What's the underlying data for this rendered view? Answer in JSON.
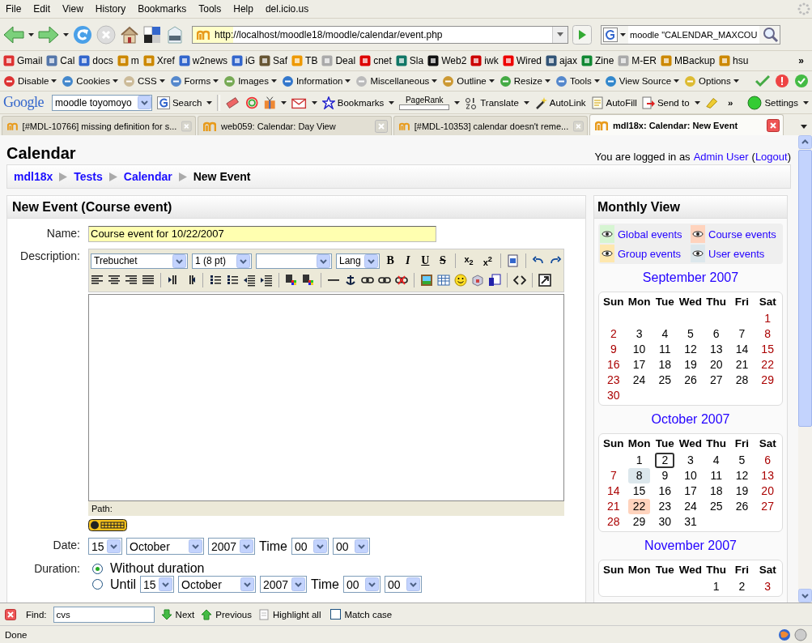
{
  "menu": [
    "File",
    "Edit",
    "View",
    "History",
    "Bookmarks",
    "Tools",
    "Help",
    "del.icio.us"
  ],
  "navigation": {
    "url": "http://localhost/moodle18/moodle/calendar/event.php",
    "search_value": "moodle \"CALENDAR_MAXCOU"
  },
  "bookmarks": [
    "Gmail",
    "Cal",
    "docs",
    "m",
    "Xref",
    "w2news",
    "iG",
    "Saf",
    "TB",
    "Deal",
    "cnet",
    "Sla",
    "Web2",
    "iwk",
    "Wired",
    "ajax",
    "Zine",
    "M-ER",
    "MBackup",
    "hsu"
  ],
  "bookmarks_overflow": "»",
  "developer_toolbar": [
    "Disable",
    "Cookies",
    "CSS",
    "Forms",
    "Images",
    "Information",
    "Miscellaneous",
    "Outline",
    "Resize",
    "Tools",
    "View Source",
    "Options"
  ],
  "google_toolbar": {
    "logo": "Google",
    "query": "moodle toyomoyo",
    "search": "Search",
    "bookmarks": "Bookmarks",
    "pagerank": "PageRank",
    "translate": "Translate",
    "autolink": "AutoLink",
    "autofill": "AutoFill",
    "send_to": "Send to",
    "overflow": "»",
    "settings": "Settings"
  },
  "tabs": [
    {
      "title": "[#MDL-10766] missing definition for s...",
      "selected": false
    },
    {
      "title": "web059: Calendar: Day View",
      "selected": false
    },
    {
      "title": "[#MDL-10353] calendar doesn't reme...",
      "selected": false
    },
    {
      "title": "mdl18x: Calendar: New Event",
      "selected": true
    }
  ],
  "page": {
    "title": "Calendar",
    "login": {
      "prefix": "You are logged in as",
      "user": "Admin User",
      "open": "(",
      "logout": "Logout",
      "close": ")"
    },
    "breadcrumb": [
      {
        "label": "mdl18x",
        "link": true
      },
      {
        "label": "Tests",
        "link": true
      },
      {
        "label": "Calendar",
        "link": true
      },
      {
        "label": "New Event",
        "link": false
      }
    ]
  },
  "form": {
    "heading": "New Event (Course event)",
    "name_label": "Name:",
    "name_value": "Course event for 10/22/2007",
    "description_label": "Description:",
    "editor": {
      "font": "Trebuchet",
      "size": "1 (8 pt)",
      "lang": "Lang",
      "format_buttons": [
        {
          "label": "B",
          "kind": "bold"
        },
        {
          "label": "I",
          "kind": "italic"
        },
        {
          "label": "U",
          "kind": "underline"
        },
        {
          "label": "S",
          "kind": "strike"
        }
      ],
      "script_buttons": [
        "x$_{2}$",
        "x$^{2}$"
      ],
      "path_label": "Path:"
    },
    "date_label": "Date:",
    "date": {
      "day": "15",
      "month": "October",
      "year": "2007",
      "time_label": "Time",
      "hour": "00",
      "minute": "00"
    },
    "duration_label": "Duration:",
    "duration_options": [
      {
        "label": "Without duration",
        "selected": true
      },
      {
        "label": "Until",
        "selected": false,
        "date": {
          "day": "15",
          "month": "October",
          "year": "2007",
          "time_label": "Time",
          "hour": "00",
          "minute": "00"
        }
      }
    ]
  },
  "sidebar": {
    "title": "Monthly View",
    "legend": [
      {
        "label": "Global events",
        "color": "#d6f5d2"
      },
      {
        "label": "Course events",
        "color": "#ffd3bd"
      },
      {
        "label": "Group events",
        "color": "#fee7ae"
      },
      {
        "label": "User events",
        "color": "#dce7ec"
      }
    ],
    "months": [
      {
        "title": "September 2007",
        "weekdays": [
          "Sun",
          "Mon",
          "Tue",
          "Wed",
          "Thu",
          "Fri",
          "Sat"
        ],
        "weeks": [
          [
            {
              "day": "1",
              "today": false
            }
          ],
          [
            {
              "day": "2",
              "today": false
            },
            {
              "day": "3",
              "today": false
            },
            {
              "day": "4",
              "today": false
            },
            {
              "day": "5",
              "today": false
            },
            {
              "day": "6",
              "today": false
            },
            {
              "day": "7",
              "today": false
            },
            {
              "day": "8",
              "today": false
            }
          ],
          [
            {
              "day": "9",
              "today": false
            },
            {
              "day": "10",
              "today": false
            },
            {
              "day": "11",
              "today": false
            },
            {
              "day": "12",
              "today": false
            },
            {
              "day": "13",
              "today": false
            },
            {
              "day": "14",
              "today": false
            },
            {
              "day": "15",
              "today": false
            }
          ],
          [
            {
              "day": "16",
              "today": false
            },
            {
              "day": "17",
              "today": false
            },
            {
              "day": "18",
              "today": false
            },
            {
              "day": "19",
              "today": false
            },
            {
              "day": "20",
              "today": false
            },
            {
              "day": "21",
              "today": false
            },
            {
              "day": "22",
              "today": false
            }
          ],
          [
            {
              "day": "23",
              "today": false
            },
            {
              "day": "24",
              "today": false
            },
            {
              "day": "25",
              "today": false
            },
            {
              "day": "26",
              "today": false
            },
            {
              "day": "27",
              "today": false
            },
            {
              "day": "28",
              "today": false
            },
            {
              "day": "29",
              "today": false
            }
          ],
          [
            {
              "day": "30",
              "today": false
            }
          ]
        ]
      },
      {
        "title": "October 2007",
        "weekdays": [
          "Sun",
          "Mon",
          "Tue",
          "Wed",
          "Thu",
          "Fri",
          "Sat"
        ],
        "weeks": [
          [
            {
              "day": "1",
              "today": false
            },
            {
              "day": "2",
              "today": true
            },
            {
              "day": "3",
              "today": false
            },
            {
              "day": "4",
              "today": false
            },
            {
              "day": "5",
              "today": false
            },
            {
              "day": "6",
              "today": false
            }
          ],
          [
            {
              "day": "7",
              "today": false
            },
            {
              "day": "8",
              "today": false,
              "color": "#dce7ec"
            },
            {
              "day": "9",
              "today": false
            },
            {
              "day": "10",
              "today": false
            },
            {
              "day": "11",
              "today": false
            },
            {
              "day": "12",
              "today": false
            },
            {
              "day": "13",
              "today": false
            }
          ],
          [
            {
              "day": "14",
              "today": false
            },
            {
              "day": "15",
              "today": false
            },
            {
              "day": "16",
              "today": false
            },
            {
              "day": "17",
              "today": false
            },
            {
              "day": "18",
              "today": false
            },
            {
              "day": "19",
              "today": false
            },
            {
              "day": "20",
              "today": false
            }
          ],
          [
            {
              "day": "21",
              "today": false
            },
            {
              "day": "22",
              "today": false,
              "color": "#ffd3bd"
            },
            {
              "day": "23",
              "today": false
            },
            {
              "day": "24",
              "today": false
            },
            {
              "day": "25",
              "today": false
            },
            {
              "day": "26",
              "today": false
            },
            {
              "day": "27",
              "today": false
            }
          ],
          [
            {
              "day": "28",
              "today": false
            },
            {
              "day": "29",
              "today": false
            },
            {
              "day": "30",
              "today": false
            },
            {
              "day": "31",
              "today": false
            }
          ]
        ]
      },
      {
        "title": "November 2007",
        "weekdays": [
          "Sun",
          "Mon",
          "Tue",
          "Wed",
          "Thu",
          "Fri",
          "Sat"
        ],
        "weeks": [
          [
            {
              "day": "1",
              "today": false
            },
            {
              "day": "2",
              "today": false
            },
            {
              "day": "3",
              "today": false
            }
          ]
        ]
      }
    ]
  },
  "find_bar": {
    "label": "Find:",
    "value": "cvs",
    "next": "Next",
    "previous": "Previous",
    "highlight": "Highlight all",
    "match_case": "Match case",
    "match_case_checked": false
  },
  "status": "Done"
}
